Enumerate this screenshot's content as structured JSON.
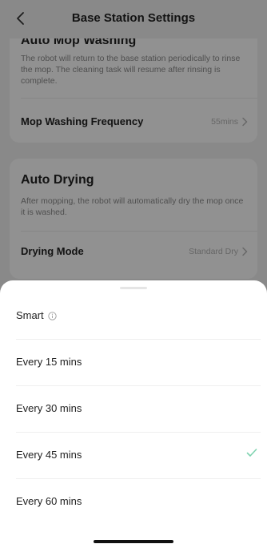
{
  "header": {
    "title": "Base Station Settings"
  },
  "auto_mop_washing": {
    "title": "Auto Mop Washing",
    "description": "The robot will return to the base station periodically to rinse the mop. The cleaning task will resume after rinsing is complete.",
    "frequency_label": "Mop Washing Frequency",
    "frequency_value": "55mins"
  },
  "auto_drying": {
    "title": "Auto Drying",
    "description": "After mopping, the robot will automatically dry the mop once it is washed.",
    "mode_label": "Drying Mode",
    "mode_value": "Standard Dry"
  },
  "sheet": {
    "options": [
      {
        "label": "Smart",
        "info_icon": "info-icon",
        "selected": false
      },
      {
        "label": "Every 15 mins",
        "selected": false
      },
      {
        "label": "Every 30 mins",
        "selected": false
      },
      {
        "label": "Every 45 mins",
        "selected": true
      },
      {
        "label": "Every 60 mins",
        "selected": false
      }
    ]
  },
  "colors": {
    "accent_check": "#7fd3b0",
    "overlay": "rgba(0,0,0,0.43)"
  }
}
